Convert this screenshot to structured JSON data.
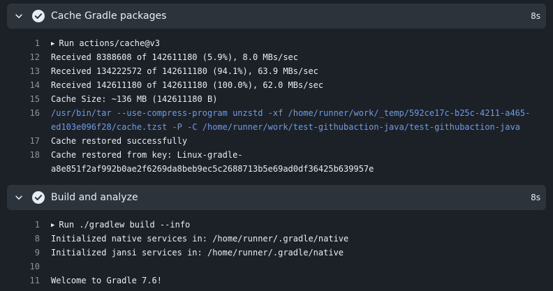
{
  "steps": [
    {
      "title": "Cache Gradle packages",
      "duration": "8s",
      "icons": {
        "expand": "chevron-down-icon",
        "status": "check-circle-icon"
      },
      "lines": [
        {
          "num": "1",
          "prefix": "▶",
          "text": "Run actions/cache@v3",
          "style": "normal"
        },
        {
          "num": "12",
          "text": "Received 8388608 of 142611180 (5.9%), 8.0 MBs/sec",
          "style": "normal"
        },
        {
          "num": "13",
          "text": "Received 134222572 of 142611180 (94.1%), 63.9 MBs/sec",
          "style": "normal"
        },
        {
          "num": "14",
          "text": "Received 142611180 of 142611180 (100.0%), 62.0 MBs/sec",
          "style": "normal"
        },
        {
          "num": "15",
          "text": "Cache Size: ~136 MB (142611180 B)",
          "style": "normal"
        },
        {
          "num": "16",
          "text": "/usr/bin/tar --use-compress-program unzstd -xf /home/runner/work/_temp/592ce17c-b25c-4211-a465-",
          "style": "cmd"
        },
        {
          "num": "",
          "text": "ed103e096f28/cache.tzst -P -C /home/runner/work/test-githubaction-java/test-githubaction-java",
          "style": "cmd"
        },
        {
          "num": "17",
          "text": "Cache restored successfully",
          "style": "normal"
        },
        {
          "num": "18",
          "text": "Cache restored from key: Linux-gradle-",
          "style": "normal"
        },
        {
          "num": "",
          "text": "a8e851f2af992b0ae2f6269da8beb9ec5c2688713b5e69ad0df36425b639957e",
          "style": "normal"
        }
      ]
    },
    {
      "title": "Build and analyze",
      "duration": "8s",
      "icons": {
        "expand": "chevron-down-icon",
        "status": "check-circle-icon"
      },
      "lines": [
        {
          "num": "1",
          "prefix": "▶",
          "text": "Run ./gradlew build --info",
          "style": "normal"
        },
        {
          "num": "8",
          "text": "Initialized native services in: /home/runner/.gradle/native",
          "style": "normal"
        },
        {
          "num": "9",
          "text": "Initialized jansi services in: /home/runner/.gradle/native",
          "style": "normal"
        },
        {
          "num": "10",
          "text": "",
          "style": "normal"
        },
        {
          "num": "11",
          "text": "Welcome to Gradle 7.6!",
          "style": "normal"
        }
      ]
    }
  ],
  "colors": {
    "background": "#1c2128",
    "header": "#2d333b",
    "text": "#e6edf3",
    "line_number": "#8b949e",
    "command": "#6f9ce6"
  }
}
